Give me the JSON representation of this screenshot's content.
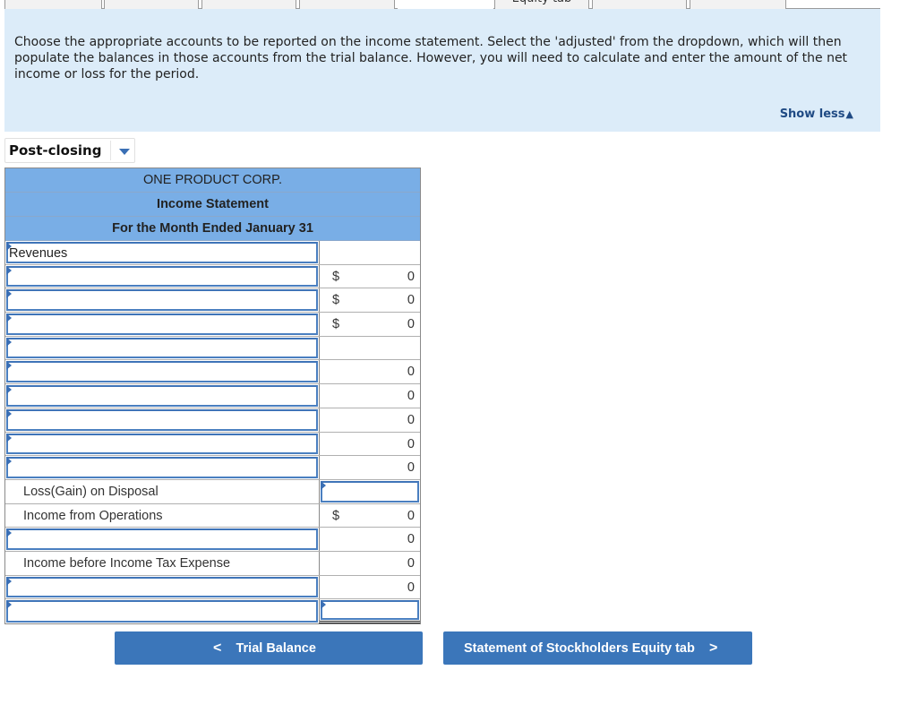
{
  "tabs": [
    {
      "label": ""
    },
    {
      "label": ""
    },
    {
      "label": ""
    },
    {
      "label": ""
    },
    {
      "label": "",
      "active": true
    },
    {
      "label": "Equity tab"
    },
    {
      "label": ""
    },
    {
      "label": ""
    }
  ],
  "instructions": {
    "text": "Choose the appropriate accounts to be reported on the income statement. Select the 'adjusted' from the dropdown, which will then populate the balances in those accounts from the trial balance. However, you will need to calculate and enter the amount of the net income or loss for the period.",
    "toggle_label": "Show less",
    "toggle_icon": "triangle-up"
  },
  "dropdown": {
    "selected": "Post-closing"
  },
  "statement": {
    "company": "ONE PRODUCT CORP.",
    "title": "Income Statement",
    "period": "For the Month Ended January 31",
    "rows": [
      {
        "type": "input",
        "label": "Revenues",
        "dollar": "",
        "amount": ""
      },
      {
        "type": "input",
        "label": "",
        "dollar": "$",
        "amount": "0"
      },
      {
        "type": "input",
        "label": "",
        "dollar": "$",
        "amount": "0"
      },
      {
        "type": "input",
        "label": "",
        "dollar": "$",
        "amount": "0"
      },
      {
        "type": "input",
        "label": "",
        "dollar": "",
        "amount": ""
      },
      {
        "type": "input",
        "label": "",
        "dollar": "",
        "amount": "0"
      },
      {
        "type": "input",
        "label": "",
        "dollar": "",
        "amount": "0"
      },
      {
        "type": "input",
        "label": "",
        "dollar": "",
        "amount": "0"
      },
      {
        "type": "input",
        "label": "",
        "dollar": "",
        "amount": "0"
      },
      {
        "type": "input",
        "label": "",
        "dollar": "",
        "amount": "0"
      },
      {
        "type": "static",
        "label": "Loss(Gain) on Disposal",
        "amount_input": true
      },
      {
        "type": "static",
        "label": "Income from Operations",
        "dollar": "$",
        "amount": "0"
      },
      {
        "type": "input",
        "label": "",
        "dollar": "",
        "amount": "0"
      },
      {
        "type": "static",
        "label": "Income before Income Tax Expense",
        "dollar": "",
        "amount": "0"
      },
      {
        "type": "input",
        "label": "",
        "dollar": "",
        "amount": "0"
      },
      {
        "type": "input",
        "label": "",
        "amount_input": true,
        "double_underline": true
      }
    ]
  },
  "nav": {
    "prev_label": "Trial Balance",
    "next_label": "Statement of Stockholders Equity tab"
  },
  "colors": {
    "header_blue": "#79aee6",
    "panel_bg": "#dcecf9",
    "button_blue": "#3b76ba",
    "link_blue": "#1f4a84"
  }
}
